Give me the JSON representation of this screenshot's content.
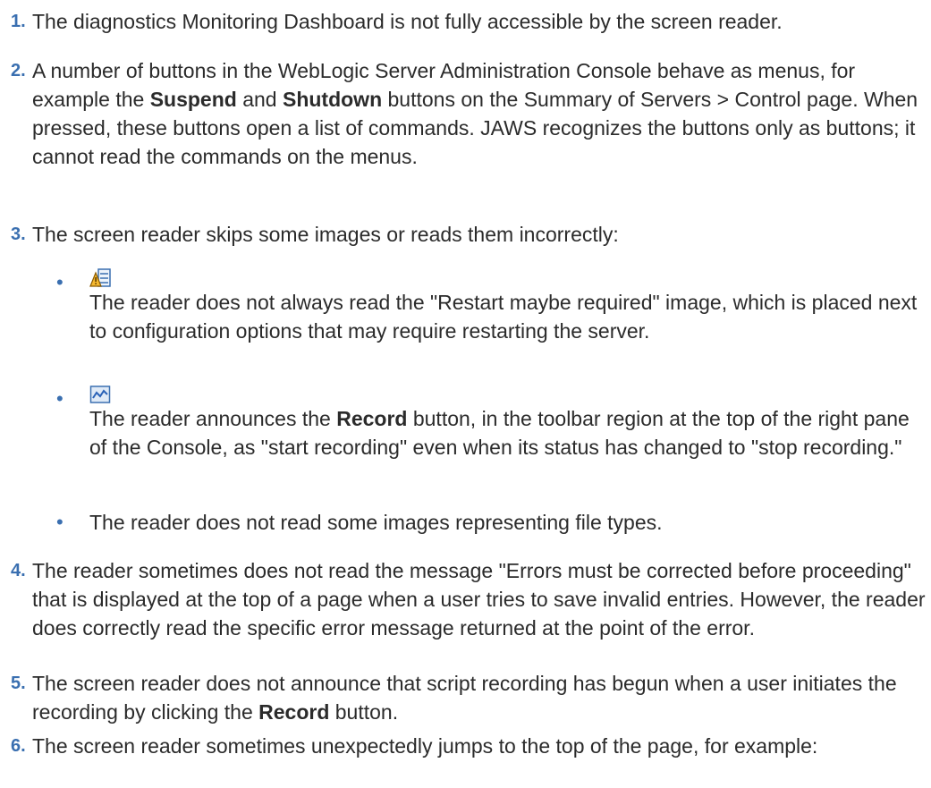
{
  "items": [
    {
      "number": "1.",
      "text": "The diagnostics Monitoring Dashboard is not fully accessible by the screen reader."
    },
    {
      "number": "2.",
      "parts": [
        "A number of buttons in the WebLogic Server Administration Console behave as menus, for example the ",
        "Suspend",
        " and ",
        "Shutdown",
        " buttons on the Summary of Servers > Control page. When pressed, these buttons open a list of commands. JAWS recognizes the buttons only as buttons; it cannot read the commands on the menus."
      ]
    },
    {
      "number": "3.",
      "text": "The screen reader skips some images or reads them incorrectly:"
    },
    {
      "number": "4.",
      "text": "The reader sometimes does not read the message \"Errors must be corrected before proceeding\" that is displayed at the top of a page when a user tries to save invalid entries. However, the reader does correctly read the specific error message returned at the point of the error."
    },
    {
      "number": "5.",
      "parts": [
        "The screen reader does not announce that script recording has begun when a user initiates the recording by clicking the ",
        "Record",
        " button."
      ]
    },
    {
      "number": "6.",
      "text": "The screen reader sometimes unexpectedly jumps to the top of the page, for example:"
    }
  ],
  "subitems": [
    {
      "bullet": "•",
      "icon": "restart-required-icon",
      "text": "The reader does not always read the \"Restart maybe required\" image, which is placed next to configuration options that may require restarting the server."
    },
    {
      "bullet": "•",
      "icon": "record-chart-icon",
      "parts": [
        "The reader announces the ",
        "Record",
        " button, in the toolbar region at the top of the right pane of the Console, as \"start recording\" even when its status has changed to \"stop recording.\""
      ]
    },
    {
      "bullet": "•",
      "text": "The reader does not read some images representing file types."
    }
  ],
  "colors": {
    "accent": "#3a6fb0",
    "text": "#2b2b2b"
  }
}
